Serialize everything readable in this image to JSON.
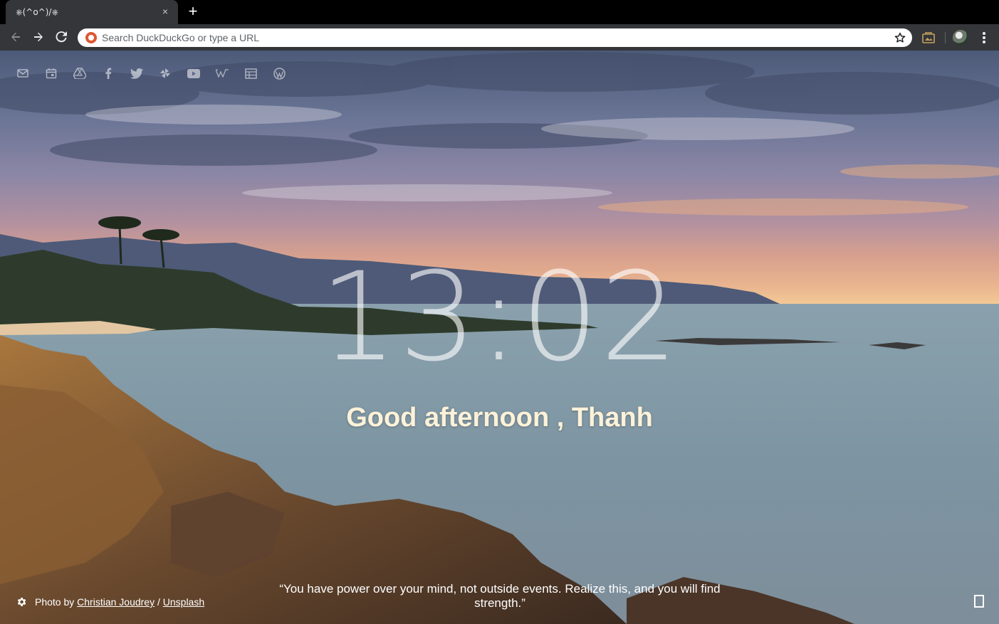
{
  "browser": {
    "tab": {
      "title": "⎈(^o^)/⎈",
      "close_glyph": "×"
    },
    "new_tab_glyph": "+",
    "omnibox": {
      "placeholder": "Search DuckDuckGo or type a URL",
      "value": ""
    },
    "toolbar_icons": [
      "back-icon",
      "forward-icon",
      "reload-icon",
      "duckduckgo-icon",
      "bookmark-star-icon",
      "extension-icon",
      "profile-avatar",
      "menu-icon"
    ]
  },
  "shortcuts": [
    "gmail",
    "calendar",
    "drive",
    "facebook",
    "twitter",
    "pinwheel",
    "youtube",
    "wikipedia",
    "table",
    "wordpress"
  ],
  "clock": {
    "time": "13:02"
  },
  "greeting": {
    "text": "Good afternoon , Thanh"
  },
  "credit": {
    "prefix": "Photo by",
    "author": "Christian Joudrey",
    "separator": "/",
    "source": "Unsplash"
  },
  "quote": {
    "text": "“You have power over your mind, not outside events. Realize this, and you will find strength.”"
  },
  "colors": {
    "tab_bg": "#35363a",
    "toolbar_bg": "#35363a",
    "tabstrip_bg": "#000000",
    "ddg_orange": "#de5833",
    "greeting": "#fdf2d8"
  }
}
